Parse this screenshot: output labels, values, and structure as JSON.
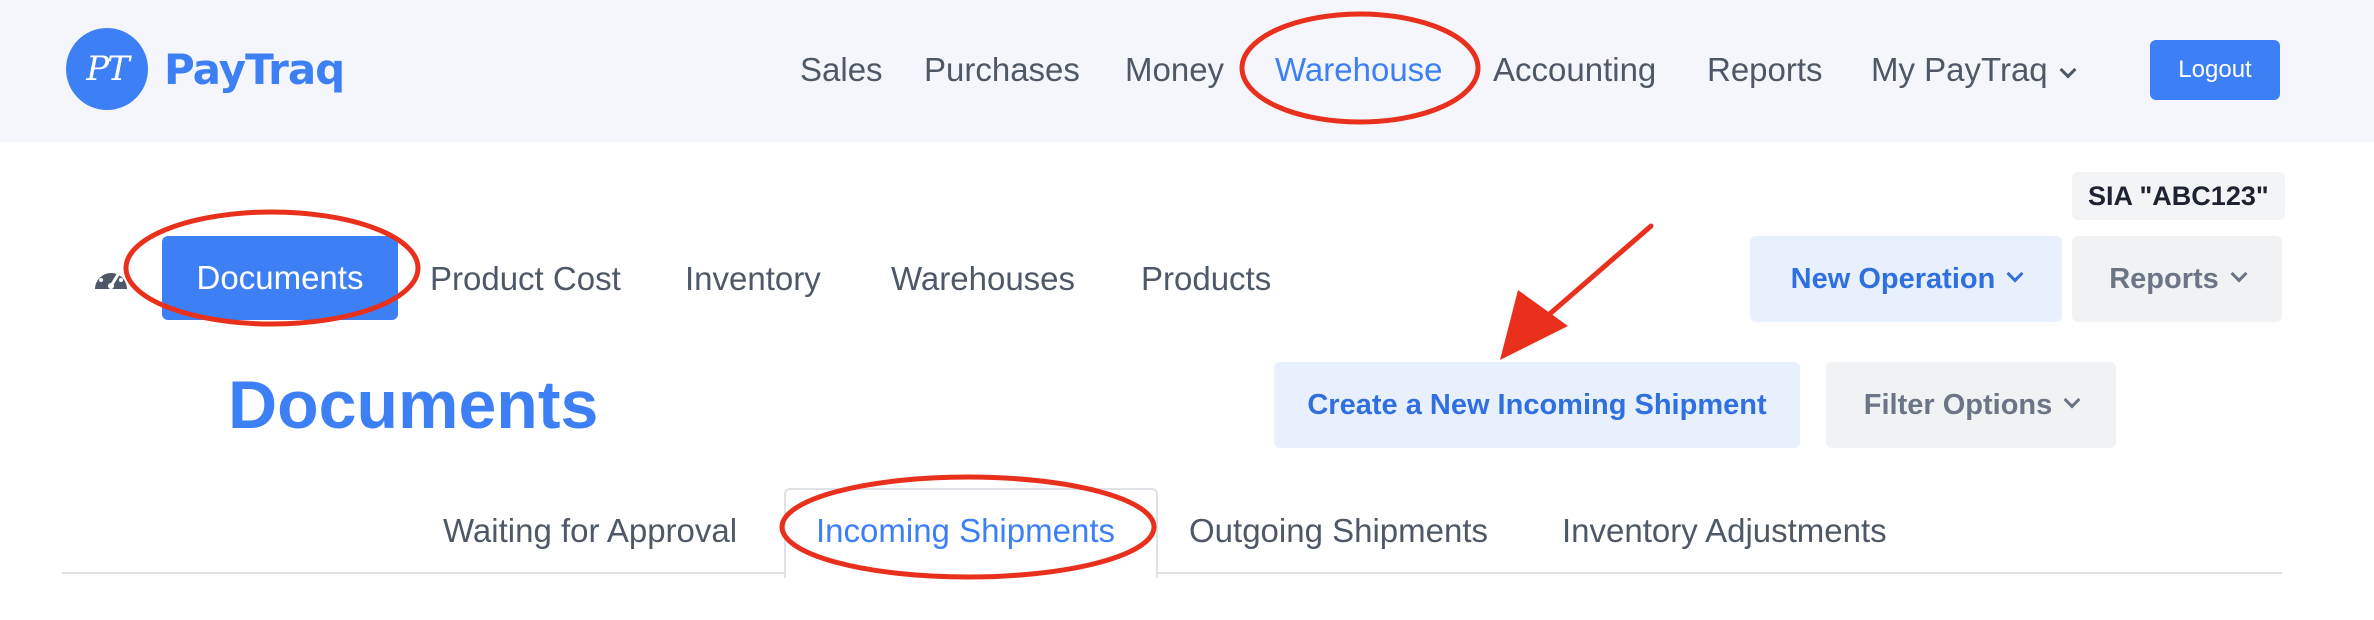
{
  "brand": {
    "logo_mark": "PT",
    "name": "PayTraq"
  },
  "main_nav": {
    "items": [
      "Sales",
      "Purchases",
      "Money",
      "Warehouse",
      "Accounting",
      "Reports",
      "My PayTraq"
    ],
    "active": "Warehouse",
    "logout_label": "Logout"
  },
  "company_badge": "SIA \"ABC123\"",
  "sub_nav": {
    "dashboard_icon": "speedometer-icon",
    "items": [
      "Documents",
      "Product Cost",
      "Inventory",
      "Warehouses",
      "Products"
    ],
    "active": "Documents",
    "new_operation_label": "New Operation",
    "reports_label": "Reports"
  },
  "page": {
    "title": "Documents",
    "create_button_label": "Create a New Incoming Shipment",
    "filter_button_label": "Filter Options"
  },
  "tabs": {
    "items": [
      "Waiting for Approval",
      "Incoming Shipments",
      "Outgoing Shipments",
      "Inventory Adjustments"
    ],
    "active": "Incoming Shipments"
  },
  "colors": {
    "accent": "#3d80f5",
    "annotation": "#e8301c"
  }
}
